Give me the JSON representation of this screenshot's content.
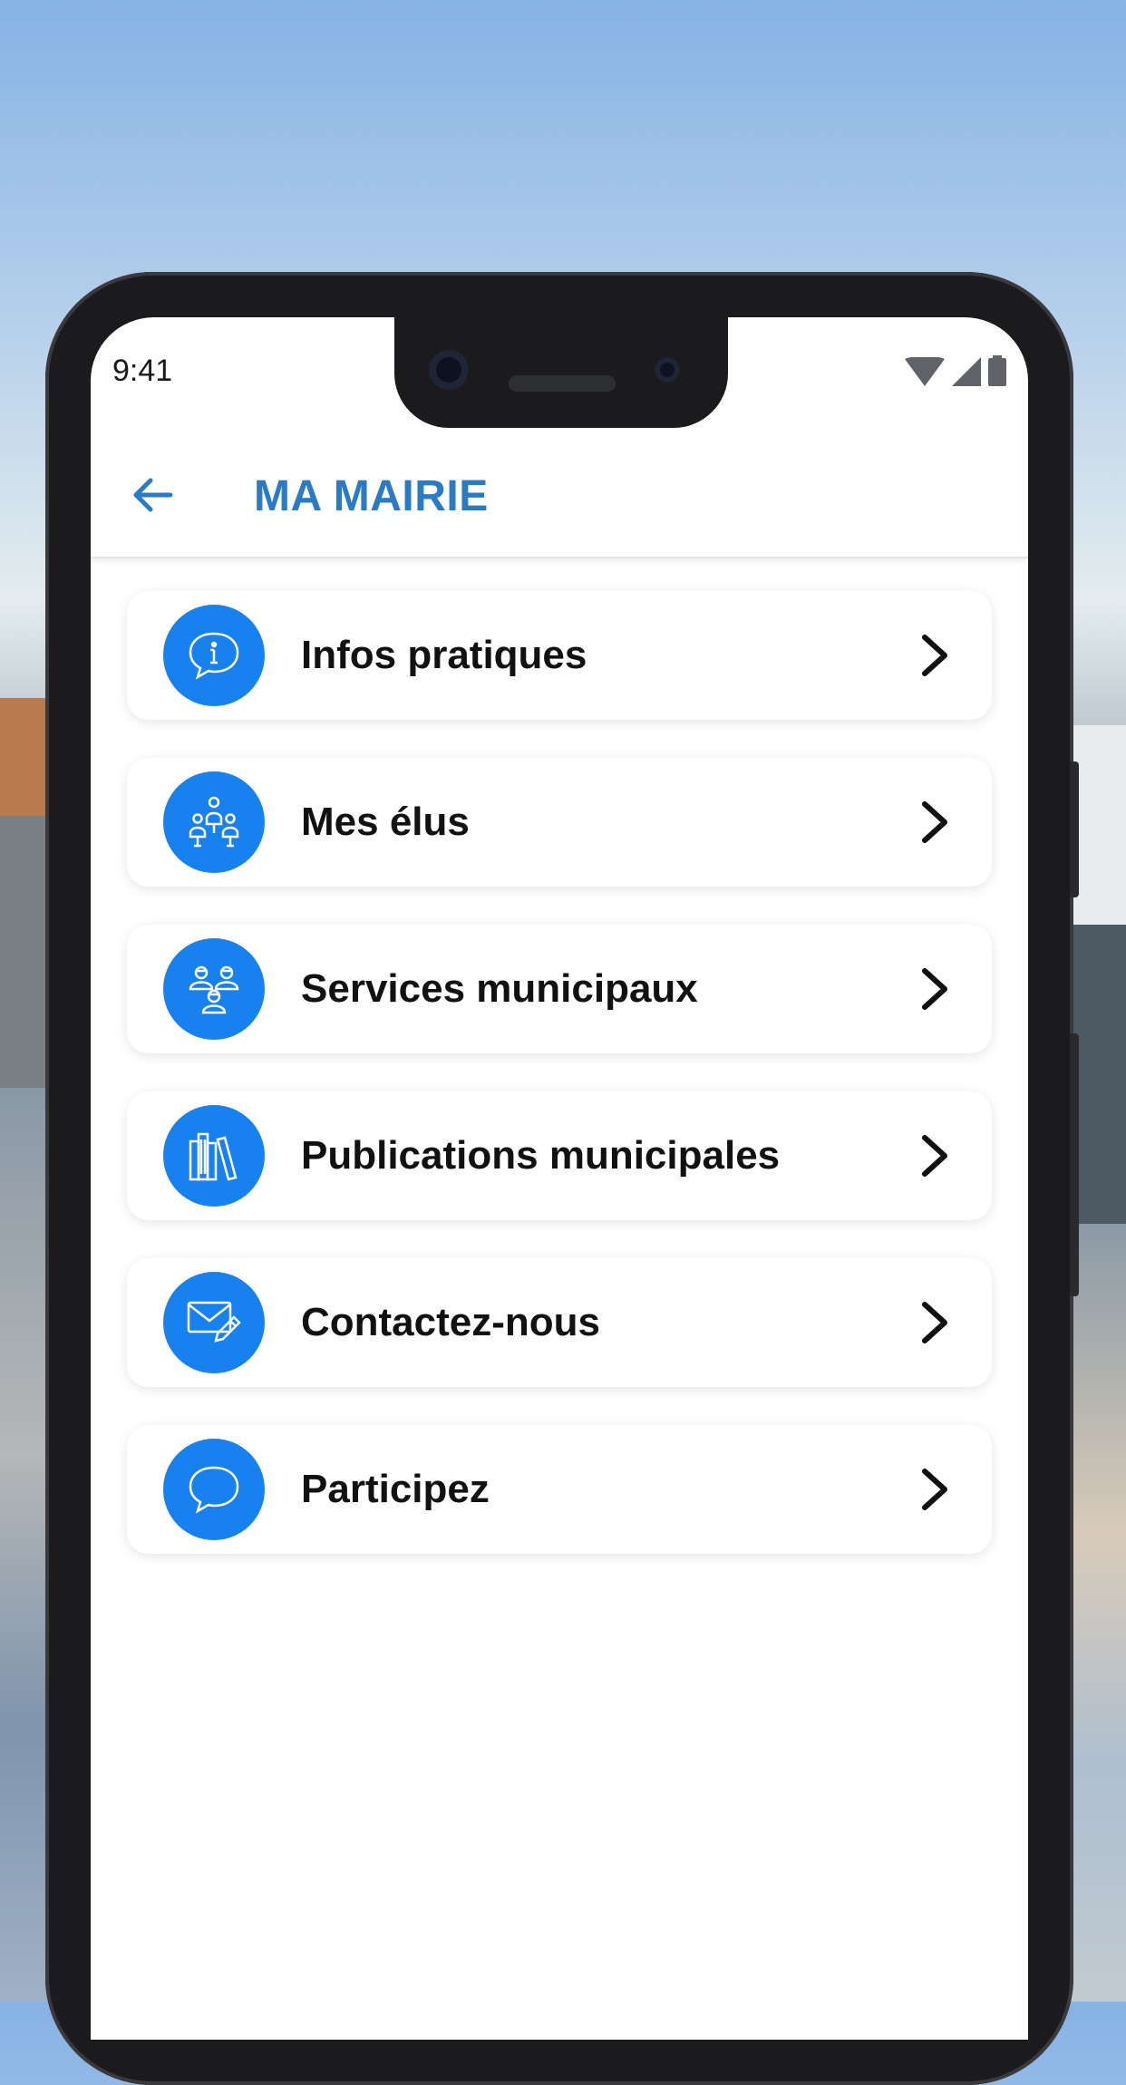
{
  "status_bar": {
    "time": "9:41"
  },
  "header": {
    "title": "MA MAIRIE",
    "back_icon": "arrow-left-icon"
  },
  "menu": [
    {
      "label": "Infos pratiques",
      "icon": "info-chat-icon"
    },
    {
      "label": "Mes élus",
      "icon": "people-group-icon"
    },
    {
      "label": "Services municipaux",
      "icon": "staff-icon"
    },
    {
      "label": "Publications municipales",
      "icon": "books-icon"
    },
    {
      "label": "Contactez-nous",
      "icon": "mail-edit-icon"
    },
    {
      "label": "Participez",
      "icon": "chat-bubble-icon"
    }
  ],
  "colors": {
    "accent": "#1781f0",
    "title": "#2a7bc4",
    "text": "#111111"
  }
}
